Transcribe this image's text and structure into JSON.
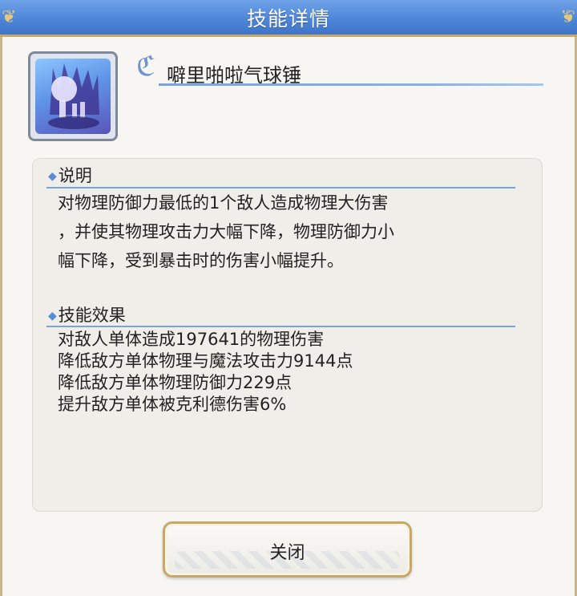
{
  "dialog": {
    "title": "技能详情"
  },
  "skill": {
    "icon": "hammer-balloon-skill-icon",
    "name": "噼里啪啦气球锤"
  },
  "sections": {
    "description_heading": "说明",
    "description_lines": [
      "对物理防御力最低的1个敌人造成物理大伤害",
      "，并使其物理攻击力大幅下降，物理防御力小",
      "幅下降，受到暴击时的伤害小幅提升。"
    ],
    "effects_heading": "技能效果",
    "effects_lines": [
      "对敌人单体造成197641的物理伤害",
      "降低敌方单体物理与魔法攻击力9144点",
      "降低敌方单体物理防御力229点",
      "提升敌方单体被克利德伤害6%"
    ]
  },
  "buttons": {
    "close_label": "关闭"
  },
  "colors": {
    "title_bar": "#4f86d8",
    "accent_line": "#7aa4d8",
    "gold_border": "#c9a865"
  }
}
